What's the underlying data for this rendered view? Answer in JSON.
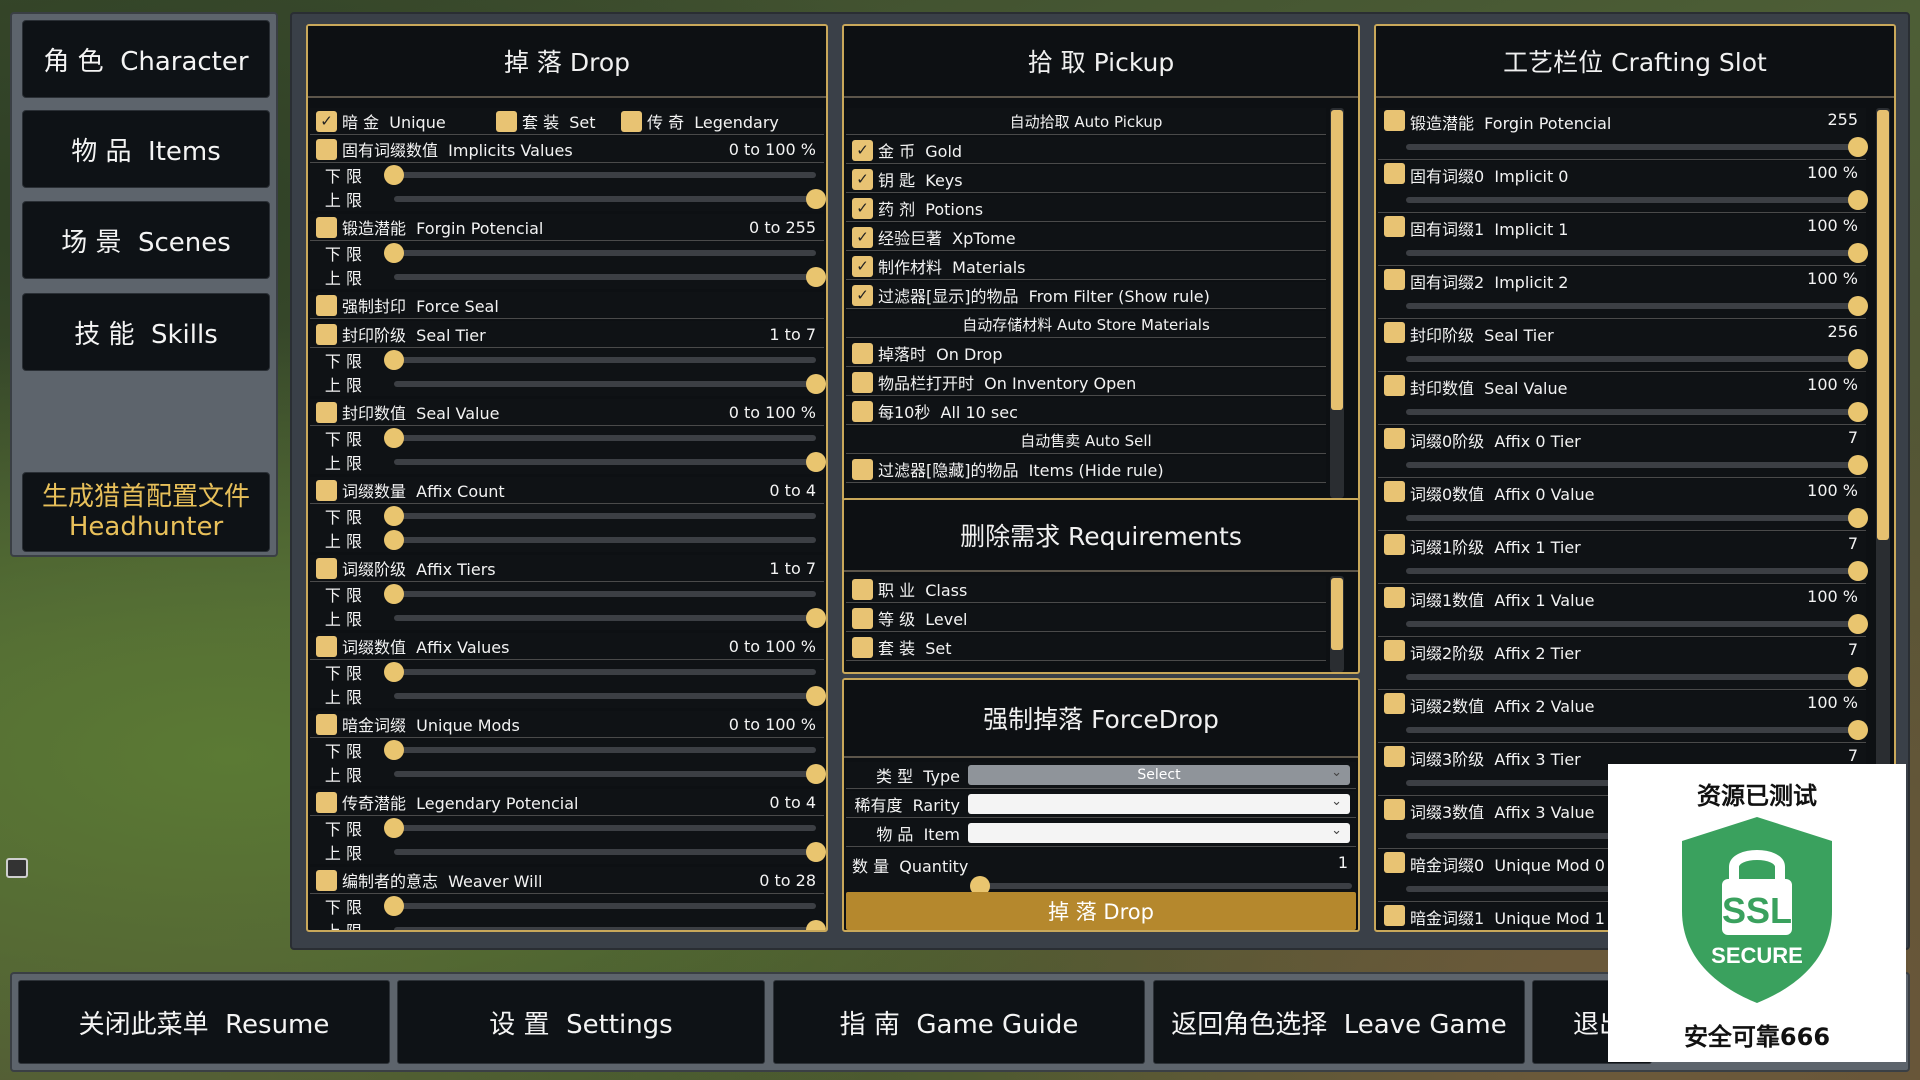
{
  "left_menu": {
    "character": "角 色  Character",
    "items": "物 品  Items",
    "scenes": "场 景  Scenes",
    "skills": "技 能  Skills",
    "headhunter_cn": "生成猎首配置文件",
    "headhunter_en": "Headhunter"
  },
  "drop": {
    "title": "掉 落  Drop",
    "types": {
      "unique": "暗 金  Unique",
      "set": "套 装  Set",
      "legendary": "传 奇  Legendary"
    },
    "lower": "下 限",
    "upper": "上 限",
    "check": "✓",
    "filters": [
      {
        "label": "固有词缀数值  Implicits Values",
        "range": "0 to 100 %",
        "low": 0,
        "high": 1
      },
      {
        "label": "锻造潜能  Forgin Potencial",
        "range": "0 to 255",
        "low": 0,
        "high": 1
      },
      {
        "label": "强制封印  Force Seal",
        "range": ""
      },
      {
        "label": "封印阶级  Seal Tier",
        "range": "1 to 7",
        "low": 0,
        "high": 1
      },
      {
        "label": "封印数值  Seal Value",
        "range": "0 to 100 %",
        "low": 0,
        "high": 1
      },
      {
        "label": "词缀数量  Affix Count",
        "range": "0 to 4",
        "low": 0,
        "high": 0
      },
      {
        "label": "词缀阶级  Affix Tiers",
        "range": "1 to 7",
        "low": 0,
        "high": 1
      },
      {
        "label": "词缀数值  Affix Values",
        "range": "0 to 100 %",
        "low": 0,
        "high": 1
      },
      {
        "label": "暗金词缀  Unique Mods",
        "range": "0 to 100 %",
        "low": 0,
        "high": 1
      },
      {
        "label": "传奇潜能  Legendary Potencial",
        "range": "0 to 4",
        "low": 0,
        "high": 1
      },
      {
        "label": "编制者的意志  Weaver Will",
        "range": "0 to 28",
        "low": 0,
        "high": 1
      }
    ]
  },
  "pickup": {
    "title": "拾 取  Pickup",
    "auto_pickup": "自动拾取  Auto Pickup",
    "auto_items": [
      "金 币  Gold",
      "钥 匙  Keys",
      "药 剂  Potions",
      "经验巨著  XpTome",
      "制作材料  Materials",
      "过滤器[显示]的物品  From Filter (Show rule)"
    ],
    "auto_store": "自动存储材料  Auto Store Materials",
    "store_items": [
      "掉落时  On Drop",
      "物品栏打开时  On Inventory Open",
      "每10秒  All 10 sec"
    ],
    "auto_sell": "自动售卖  Auto Sell",
    "sell_items": [
      "过滤器[隐藏]的物品  Items (Hide rule)"
    ]
  },
  "requirements": {
    "title": "删除需求  Requirements",
    "items": [
      "职 业  Class",
      "等 级  Level",
      "套 装  Set"
    ]
  },
  "forcedrop": {
    "title": "强制掉落  ForceDrop",
    "type_label": "类 型  Type",
    "type_value": "Select",
    "rarity_label": "稀有度  Rarity",
    "item_label": "物 品  Item",
    "quantity_label": "数 量  Quantity",
    "quantity_value": "1",
    "quantity_fraction": 0,
    "drop_button": "掉 落  Drop"
  },
  "crafting": {
    "title": "工艺栏位  Crafting Slot",
    "slots": [
      {
        "label": "锻造潜能  Forgin Potencial",
        "value": "255",
        "fraction": 1
      },
      {
        "label": "固有词缀0  Implicit 0",
        "value": "100 %",
        "fraction": 1
      },
      {
        "label": "固有词缀1  Implicit 1",
        "value": "100 %",
        "fraction": 1
      },
      {
        "label": "固有词缀2  Implicit 2",
        "value": "100 %",
        "fraction": 1
      },
      {
        "label": "封印阶级  Seal Tier",
        "value": "256",
        "fraction": 1
      },
      {
        "label": "封印数值  Seal Value",
        "value": "100 %",
        "fraction": 1
      },
      {
        "label": "词缀0阶级  Affix 0 Tier",
        "value": "7",
        "fraction": 1
      },
      {
        "label": "词缀0数值  Affix 0 Value",
        "value": "100 %",
        "fraction": 1
      },
      {
        "label": "词缀1阶级  Affix 1 Tier",
        "value": "7",
        "fraction": 1
      },
      {
        "label": "词缀1数值  Affix 1 Value",
        "value": "100 %",
        "fraction": 1
      },
      {
        "label": "词缀2阶级  Affix 2 Tier",
        "value": "7",
        "fraction": 1
      },
      {
        "label": "词缀2数值  Affix 2 Value",
        "value": "100 %",
        "fraction": 1
      },
      {
        "label": "词缀3阶级  Affix 3 Tier",
        "value": "7",
        "fraction": 1
      },
      {
        "label": "词缀3数值  Affix 3 Value",
        "value": "",
        "fraction": 1
      },
      {
        "label": "暗金词缀0  Unique Mod 0",
        "value": "",
        "fraction": 1
      },
      {
        "label": "暗金词缀1  Unique Mod 1",
        "value": "",
        "fraction": 1
      }
    ]
  },
  "bottom": {
    "resume": "关闭此菜单  Resume",
    "settings": "设 置  Settings",
    "guide": "指 南  Game Guide",
    "leave": "返回角色选择  Leave Game",
    "quit": "退出"
  },
  "ssl_badge": {
    "top": "资源已测试",
    "ssl": "SSL",
    "secure": "SECURE",
    "bottom": "安全可靠666",
    "color": "#3aa15e"
  }
}
